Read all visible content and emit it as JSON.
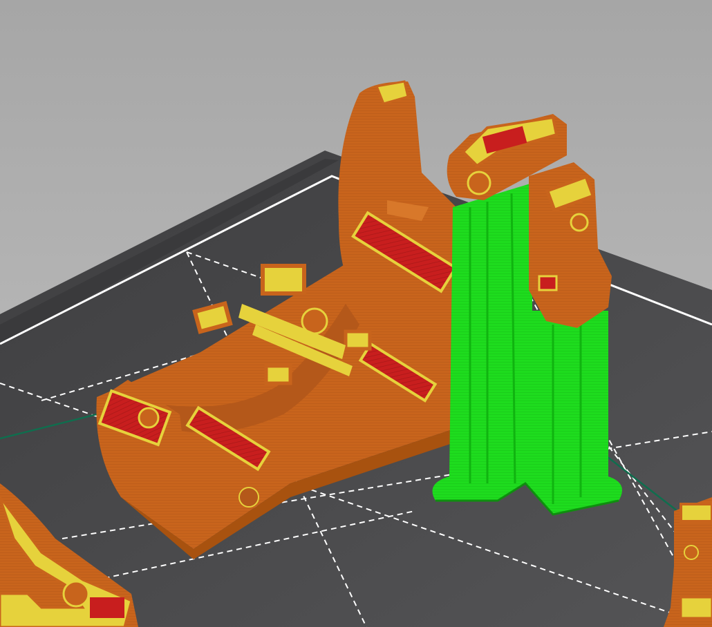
{
  "app": {
    "view": "3d-slice-preview"
  },
  "colors": {
    "background_top": "#a6a6a6",
    "background_bottom": "#c2c2c2",
    "bed": "#4a4a4c",
    "bed_edge": "#3a3a3c",
    "bed_border": "#ffffff",
    "grid_line": "#ffffff",
    "perimeter": "#c8641c",
    "perimeter_shadow": "#a8520f",
    "perimeter_light": "#d8782a",
    "solid_infill": "#c81e1e",
    "infill_lines": "#e6d23c",
    "support": "#1edc1e",
    "support_shadow": "#10b410",
    "skirt": "#0f6e4e"
  },
  "objects": [
    {
      "name": "cable-clamp-part",
      "feature": "perimeter"
    },
    {
      "name": "support-column",
      "feature": "support-material"
    },
    {
      "name": "hinge-bracket-part",
      "feature": "perimeter"
    },
    {
      "name": "corner-part-left",
      "feature": "perimeter"
    },
    {
      "name": "corner-part-right",
      "feature": "perimeter"
    }
  ]
}
